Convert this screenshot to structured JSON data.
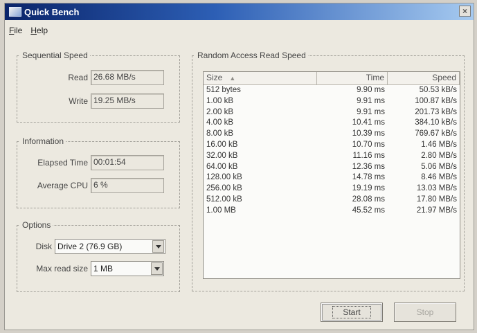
{
  "window": {
    "title": "Quick Bench",
    "close_glyph": "×"
  },
  "menu": [
    {
      "label": "File",
      "mnemonic": "F",
      "rest": "ile"
    },
    {
      "label": "Help",
      "mnemonic": "H",
      "rest": "elp"
    }
  ],
  "sequential": {
    "legend": "Sequential Speed",
    "read_label": "Read",
    "read_value": "26.68 MB/s",
    "write_label": "Write",
    "write_value": "19.25 MB/s"
  },
  "information": {
    "legend": "Information",
    "elapsed_label": "Elapsed Time",
    "elapsed_value": "00:01:54",
    "cpu_label": "Average CPU",
    "cpu_value": "6 %"
  },
  "options": {
    "legend": "Options",
    "disk_label": "Disk",
    "disk_value": "Drive 2 (76.9 GB)",
    "maxread_label": "Max read size",
    "maxread_value": "1 MB"
  },
  "random": {
    "legend": "Random Access Read Speed",
    "columns": [
      "Size",
      "Time",
      "Speed"
    ],
    "rows": [
      [
        "512 bytes",
        "9.90 ms",
        "50.53 kB/s"
      ],
      [
        "1.00 kB",
        "9.91 ms",
        "100.87 kB/s"
      ],
      [
        "2.00 kB",
        "9.91 ms",
        "201.73 kB/s"
      ],
      [
        "4.00 kB",
        "10.41 ms",
        "384.10 kB/s"
      ],
      [
        "8.00 kB",
        "10.39 ms",
        "769.67 kB/s"
      ],
      [
        "16.00 kB",
        "10.70 ms",
        "1.46 MB/s"
      ],
      [
        "32.00 kB",
        "11.16 ms",
        "2.80 MB/s"
      ],
      [
        "64.00 kB",
        "12.36 ms",
        "5.06 MB/s"
      ],
      [
        "128.00 kB",
        "14.78 ms",
        "8.46 MB/s"
      ],
      [
        "256.00 kB",
        "19.19 ms",
        "13.03 MB/s"
      ],
      [
        "512.00 kB",
        "28.08 ms",
        "17.80 MB/s"
      ],
      [
        "1.00 MB",
        "45.52 ms",
        "21.97 MB/s"
      ]
    ]
  },
  "buttons": {
    "start": "Start",
    "stop": "Stop"
  },
  "icons": {
    "sort": "sort-up-icon",
    "dropdown": "chevron-down-icon"
  }
}
